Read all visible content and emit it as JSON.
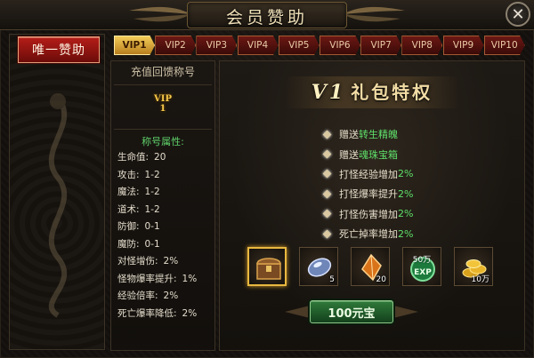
{
  "window": {
    "title": "会员赞助"
  },
  "left_nav": {
    "sponsor_button": "唯一赞助"
  },
  "tabs": [
    {
      "label": "VIP1",
      "active": true
    },
    {
      "label": "VIP2",
      "active": false
    },
    {
      "label": "VIP3",
      "active": false
    },
    {
      "label": "VIP4",
      "active": false
    },
    {
      "label": "VIP5",
      "active": false
    },
    {
      "label": "VIP6",
      "active": false
    },
    {
      "label": "VIP7",
      "active": false
    },
    {
      "label": "VIP8",
      "active": false
    },
    {
      "label": "VIP9",
      "active": false
    },
    {
      "label": "VIP10",
      "active": false
    }
  ],
  "info": {
    "heading": "充值回馈称号",
    "badge_line1": "VIP",
    "badge_line2": "1",
    "attr_title": "称号属性:",
    "attributes": [
      {
        "key": "生命值:",
        "value": "20"
      },
      {
        "key": "攻击:",
        "value": "1-2"
      },
      {
        "key": "魔法:",
        "value": "1-2"
      },
      {
        "key": "道术:",
        "value": "1-2"
      },
      {
        "key": "防御:",
        "value": "0-1"
      },
      {
        "key": "魔防:",
        "value": "0-1"
      },
      {
        "key": "对怪增伤:",
        "value": "2%"
      },
      {
        "key": "怪物爆率提升:",
        "value": "1%"
      },
      {
        "key": "经验倍率:",
        "value": "2%"
      },
      {
        "key": "死亡爆率降低:",
        "value": "2%"
      }
    ]
  },
  "main": {
    "title_prefix": "V1",
    "title_rest": "礼包特权",
    "perks": [
      {
        "text": "赠送",
        "highlight": "转生精魄"
      },
      {
        "text": "赠送",
        "highlight": "魂珠宝箱"
      },
      {
        "text": "打怪经验增加",
        "highlight": "2%"
      },
      {
        "text": "打怪爆率提升",
        "highlight": "2%"
      },
      {
        "text": "打怪伤害增加",
        "highlight": "2%"
      },
      {
        "text": "死亡掉率增加",
        "highlight": "2%"
      }
    ],
    "items": [
      {
        "icon": "treasure-chest-icon",
        "qty": "",
        "label": "",
        "selected": true
      },
      {
        "icon": "blue-gem-icon",
        "qty": "5",
        "label": "",
        "selected": false
      },
      {
        "icon": "orange-crystal-icon",
        "qty": "20",
        "label": "",
        "selected": false
      },
      {
        "icon": "exp-orb-icon",
        "qty": "",
        "label": "50万",
        "selected": false
      },
      {
        "icon": "gold-coins-icon",
        "qty": "10万",
        "label": "",
        "selected": false
      }
    ],
    "claim_button": "100元宝"
  },
  "colors": {
    "accent_gold": "#f4cc58",
    "tab_red": "#6b1813",
    "highlight_green": "#5fe06a",
    "button_red": "#b51d18",
    "button_green": "#2f7a3a"
  }
}
